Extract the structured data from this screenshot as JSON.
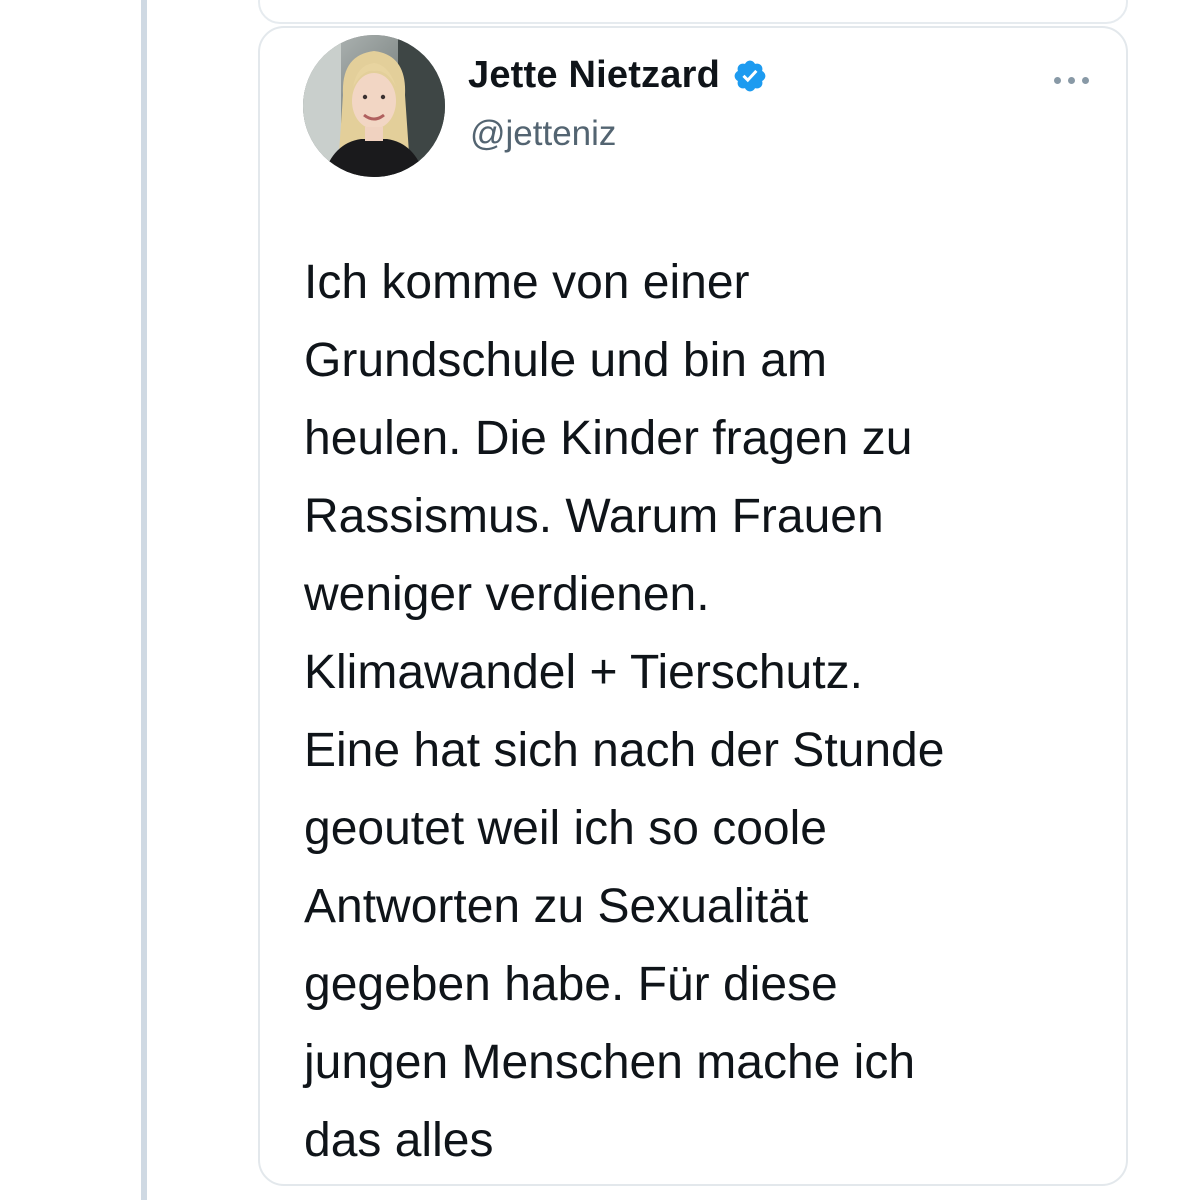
{
  "tweet": {
    "author": {
      "display_name": "Jette Nietzard",
      "handle": "@jetteniz",
      "verified": true,
      "avatar_icon": "profile-photo",
      "verified_icon": "verified-badge-icon"
    },
    "text": "Ich komme von einer\nGrundschule und bin am\nheulen. Die Kinder fragen zu\nRassismus. Warum Frauen\nweniger verdienen.\nKlimawandel + Tierschutz.\nEine hat sich nach der Stunde\ngeoutet weil ich so coole\nAntworten zu Sexualität\ngegeben habe. Für diese\njungen Menschen mache ich\ndas alles",
    "more_icon": "more-options-icon"
  },
  "colors": {
    "accent": "#1d9bf0",
    "text": "#0f1419",
    "secondary_text": "#536471",
    "border": "#e3e8ec",
    "thread_line": "#cfd9e3"
  }
}
